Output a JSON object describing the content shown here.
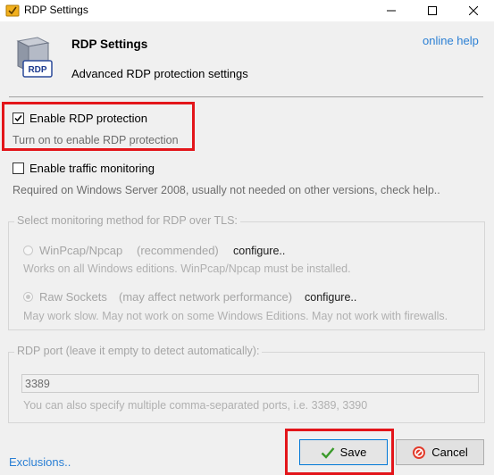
{
  "window": {
    "title": "RDP Settings"
  },
  "header": {
    "title": "RDP Settings",
    "subtitle": "Advanced RDP protection settings",
    "online_help": "online help",
    "icon_text": "RDP"
  },
  "options": {
    "enable_rdp": {
      "label": "Enable RDP protection",
      "checked": true,
      "hint": "Turn on to enable RDP protection"
    },
    "traffic": {
      "label": "Enable traffic monitoring",
      "checked": false,
      "hint": "Required on Windows Server 2008, usually not needed on other versions, check help.."
    }
  },
  "monitoring": {
    "group_title": "Select monitoring method for RDP over TLS:",
    "winpcap": {
      "label": "WinPcap/Npcap",
      "tag": "(recommended)",
      "configure": "configure..",
      "hint": "Works on all Windows editions. WinPcap/Npcap must be installed.",
      "selected": false
    },
    "raw": {
      "label": "Raw Sockets",
      "tag": "(may affect network performance)",
      "configure": "configure..",
      "hint": "May work slow. May not work on some Windows Editions. May not work with firewalls.",
      "selected": true
    }
  },
  "port": {
    "group_title": "RDP port (leave it empty to detect automatically):",
    "value": "3389",
    "hint": "You can also specify multiple comma-separated ports, i.e. 3389, 3390"
  },
  "footer": {
    "exclusions": "Exclusions..",
    "save": "Save",
    "cancel": "Cancel"
  },
  "colors": {
    "highlight": "#e3151a",
    "link": "#2a7fd4"
  }
}
